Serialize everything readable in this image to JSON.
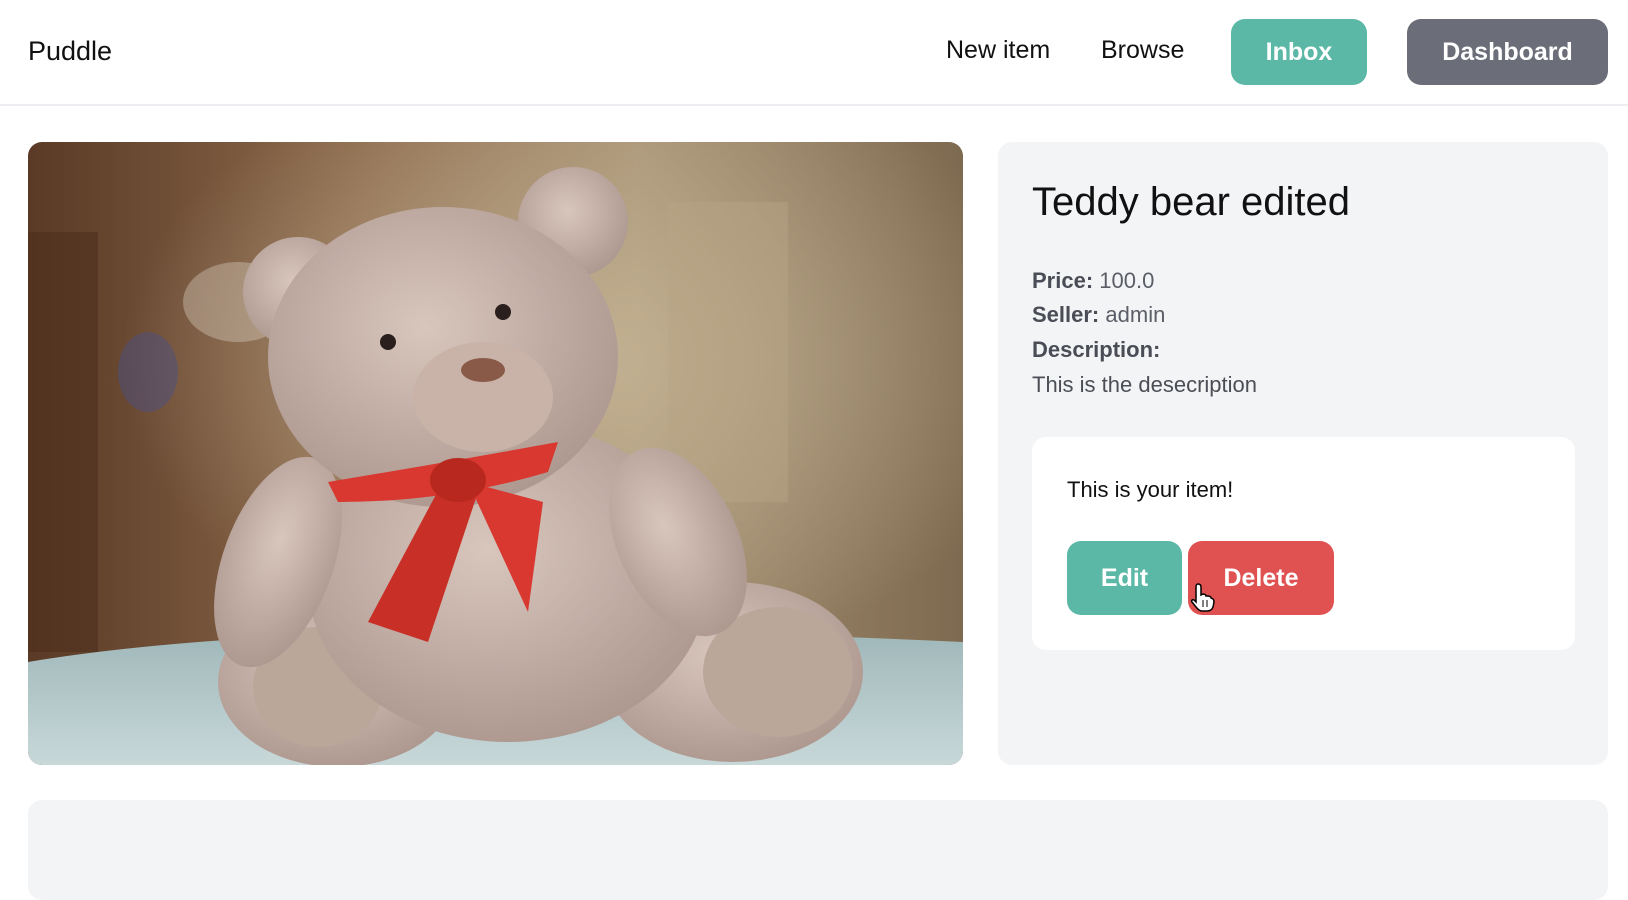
{
  "header": {
    "brand": "Puddle",
    "nav": {
      "new_item": "New item",
      "browse": "Browse",
      "inbox": "Inbox",
      "dashboard": "Dashboard"
    }
  },
  "item": {
    "image_name": "teddy-bear-photo",
    "title": "Teddy bear edited",
    "price_label": "Price:",
    "price_value": "100.0",
    "seller_label": "Seller:",
    "seller_value": "admin",
    "description_label": "Description:",
    "description_value": "This is the desecription"
  },
  "owner_panel": {
    "message": "This is your item!",
    "edit_label": "Edit",
    "delete_label": "Delete"
  },
  "colors": {
    "accent_teal": "#5bb8a6",
    "danger_red": "#e05252",
    "neutral_gray": "#6b6e79",
    "panel_bg": "#f3f4f6"
  }
}
